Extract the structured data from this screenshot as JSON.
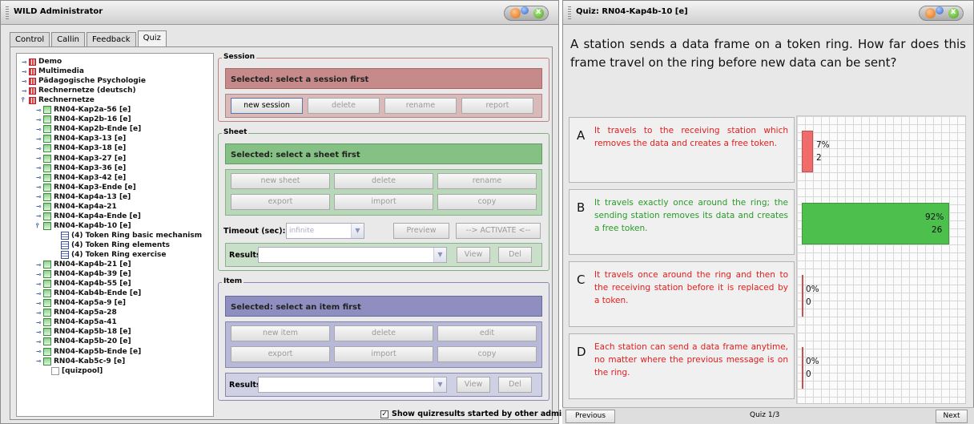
{
  "admin_window": {
    "title": "WILD Administrator",
    "tabs": [
      "Control",
      "Callin",
      "Feedback",
      "Quiz"
    ],
    "active_tab": "Quiz",
    "tree": [
      {
        "label": "Demo",
        "icon": "course-icon",
        "toggle": "o-"
      },
      {
        "label": "Multimedia",
        "icon": "course-icon",
        "toggle": "o-"
      },
      {
        "label": "Pädagogische Psychologie",
        "icon": "course-icon",
        "toggle": "o-"
      },
      {
        "label": "Rechnernetze (deutsch)",
        "icon": "course-icon",
        "toggle": "o-"
      },
      {
        "label": "Rechnernetze",
        "icon": "course-icon",
        "toggle": "o"
      },
      {
        "label": "RN04-Kap2a-56 [e]",
        "icon": "sheet-icon",
        "toggle": "o-"
      },
      {
        "label": "RN04-Kap2b-16 [e]",
        "icon": "sheet-icon",
        "toggle": "o-"
      },
      {
        "label": "RN04-Kap2b-Ende [e]",
        "icon": "sheet-icon",
        "toggle": "o-"
      },
      {
        "label": "RN04-Kap3-13 [e]",
        "icon": "sheet-icon",
        "toggle": "o-"
      },
      {
        "label": "RN04-Kap3-18 [e]",
        "icon": "sheet-icon",
        "toggle": "o-"
      },
      {
        "label": "RN04-Kap3-27 [e]",
        "icon": "sheet-icon",
        "toggle": "o-"
      },
      {
        "label": "RN04-Kap3-36 [e]",
        "icon": "sheet-icon",
        "toggle": "o-"
      },
      {
        "label": "RN04-Kap3-42 [e]",
        "icon": "sheet-icon",
        "toggle": "o-"
      },
      {
        "label": "RN04-Kap3-Ende [e]",
        "icon": "sheet-icon",
        "toggle": "o-"
      },
      {
        "label": "RN04-Kap4a-13 [e]",
        "icon": "sheet-icon",
        "toggle": "o-"
      },
      {
        "label": "RN04-Kap4a-21",
        "icon": "sheet-icon",
        "toggle": "o-"
      },
      {
        "label": "RN04-Kap4a-Ende [e]",
        "icon": "sheet-icon",
        "toggle": "o-"
      },
      {
        "label": "RN04-Kap4b-10 [e]",
        "icon": "sheet-icon",
        "toggle": "o"
      },
      {
        "label": "(4) Token Ring basic mechanism",
        "icon": "item-icon",
        "toggle": ""
      },
      {
        "label": "(4) Token Ring elements",
        "icon": "item-icon",
        "toggle": ""
      },
      {
        "label": "(4) Token Ring exercise",
        "icon": "item-icon",
        "toggle": ""
      },
      {
        "label": "RN04-Kap4b-21 [e]",
        "icon": "sheet-icon",
        "toggle": "o-"
      },
      {
        "label": "RN04-Kap4b-39 [e]",
        "icon": "sheet-icon",
        "toggle": "o-"
      },
      {
        "label": "RN04-Kap4b-55 [e]",
        "icon": "sheet-icon",
        "toggle": "o-"
      },
      {
        "label": "RN04-Kab4b-Ende [e]",
        "icon": "sheet-icon",
        "toggle": "o-"
      },
      {
        "label": "RN04-Kap5a-9 [e]",
        "icon": "sheet-icon",
        "toggle": "o-"
      },
      {
        "label": "RN04-Kap5a-28",
        "icon": "sheet-icon",
        "toggle": "o-"
      },
      {
        "label": "RN04-Kap5a-41",
        "icon": "sheet-icon",
        "toggle": "o-"
      },
      {
        "label": "RN04-Kap5b-18 [e]",
        "icon": "sheet-icon",
        "toggle": "o-"
      },
      {
        "label": "RN04-Kap5b-20 [e]",
        "icon": "sheet-icon",
        "toggle": "o-"
      },
      {
        "label": "RN04-Kap5b-Ende [e]",
        "icon": "sheet-icon",
        "toggle": "o-"
      },
      {
        "label": "RN04-Kab5c-9 [e]",
        "icon": "sheet-icon",
        "toggle": "o-"
      },
      {
        "label": "[quizpool]",
        "icon": "pool-icon",
        "toggle": ""
      }
    ],
    "session": {
      "legend": "Session",
      "selected": "Selected:   select a session first",
      "buttons": [
        "new session",
        "delete",
        "rename",
        "report"
      ]
    },
    "sheet": {
      "legend": "Sheet",
      "selected": "Selected:   select a sheet first",
      "buttons": [
        "new sheet",
        "delete",
        "rename",
        "export",
        "import",
        "copy"
      ],
      "timeout_label": "Timeout (sec):",
      "timeout_value": "infinite",
      "preview": "Preview",
      "activate": "--> ACTIVATE <--",
      "results_label": "Results:",
      "view": "View",
      "del": "Del"
    },
    "item": {
      "legend": "Item",
      "selected": "Selected:   select an item first",
      "buttons": [
        "new item",
        "delete",
        "edit",
        "export",
        "import",
        "copy"
      ],
      "results_label": "Results:",
      "view": "View",
      "del": "Del"
    },
    "show_results_label": "Show quizresults started by other admin",
    "show_results_checked": true
  },
  "quiz_window": {
    "title": "Quiz: RN04-Kap4b-10 [e]",
    "question": "A station sends a data frame on a token ring. How far does this frame travel on the ring before new data can be sent?",
    "answers": [
      {
        "letter": "A",
        "text": "It travels to the receiving station which removes the data and creates a free token.",
        "color": "#e02020"
      },
      {
        "letter": "B",
        "text": "It travels exactly once around the ring; the sending station removes its data and creates a free token.",
        "color": "#2a9a2a"
      },
      {
        "letter": "C",
        "text": "It travels once around the ring and then to the receiving station before it is replaced by a token.",
        "color": "#e02020"
      },
      {
        "letter": "D",
        "text": "Each station can send a data frame anytime, no matter where the previous message is on the ring.",
        "color": "#e02020"
      }
    ],
    "previous": "Previous",
    "page": "Quiz 1/3",
    "next": "Next"
  },
  "chart_data": {
    "type": "bar",
    "orientation": "horizontal",
    "categories": [
      "A",
      "B",
      "C",
      "D"
    ],
    "series": [
      {
        "values": [
          7,
          92,
          0,
          0
        ],
        "unit": "%"
      },
      {
        "values": [
          2,
          26,
          0,
          0
        ],
        "unit": "count"
      }
    ],
    "percent_labels": [
      "7%",
      "92%",
      "0%",
      "0%"
    ],
    "count_labels": [
      "2",
      "26",
      "0",
      "0"
    ],
    "bar_colors": [
      "#f06c6c",
      "#4cbf4c",
      "#f06c6c",
      "#f06c6c"
    ],
    "xlim": [
      0,
      100
    ],
    "grid": true
  }
}
